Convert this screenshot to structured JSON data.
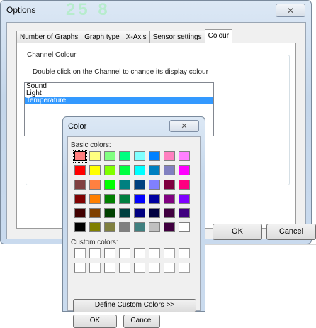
{
  "options_window": {
    "title": "Options",
    "background_digits": "25 8",
    "close_glyph": "✕",
    "tabs": [
      {
        "label": "Number of Graphs",
        "active": false
      },
      {
        "label": "Graph type",
        "active": false
      },
      {
        "label": "X-Axis",
        "active": false
      },
      {
        "label": "Sensor settings",
        "active": false
      },
      {
        "label": "Colour",
        "active": true
      }
    ],
    "group_label": "Channel Colour",
    "instruction": "Double click on the Channel to change its display colour",
    "channels": [
      {
        "label": "Sound",
        "selected": false
      },
      {
        "label": "Light",
        "selected": false
      },
      {
        "label": "Temperature",
        "selected": true
      }
    ],
    "ok_label": "OK",
    "cancel_label": "Cancel"
  },
  "color_dialog": {
    "title": "Color",
    "close_glyph": "✕",
    "basic_colors_label": "Basic colors:",
    "basic_colors": [
      "#ff8080",
      "#ffff80",
      "#80ff80",
      "#00ff80",
      "#80ffff",
      "#0080ff",
      "#ff80c0",
      "#ff80ff",
      "#ff0000",
      "#ffff00",
      "#80ff00",
      "#00ff40",
      "#00ffff",
      "#0080c0",
      "#8080c0",
      "#ff00ff",
      "#804040",
      "#ff8040",
      "#00ff00",
      "#008080",
      "#004080",
      "#8080ff",
      "#800040",
      "#ff0080",
      "#800000",
      "#ff8000",
      "#008000",
      "#008040",
      "#0000ff",
      "#0000a0",
      "#800080",
      "#8000ff",
      "#400000",
      "#804000",
      "#004000",
      "#004040",
      "#000080",
      "#000040",
      "#400040",
      "#400080",
      "#000000",
      "#808000",
      "#808040",
      "#808080",
      "#408080",
      "#c0c0c0",
      "#400040",
      "#ffffff"
    ],
    "selected_index": 0,
    "custom_colors_label": "Custom colors:",
    "custom_colors_count": 16,
    "define_label": "Define Custom Colors >>",
    "ok_label": "OK",
    "cancel_label": "Cancel"
  }
}
